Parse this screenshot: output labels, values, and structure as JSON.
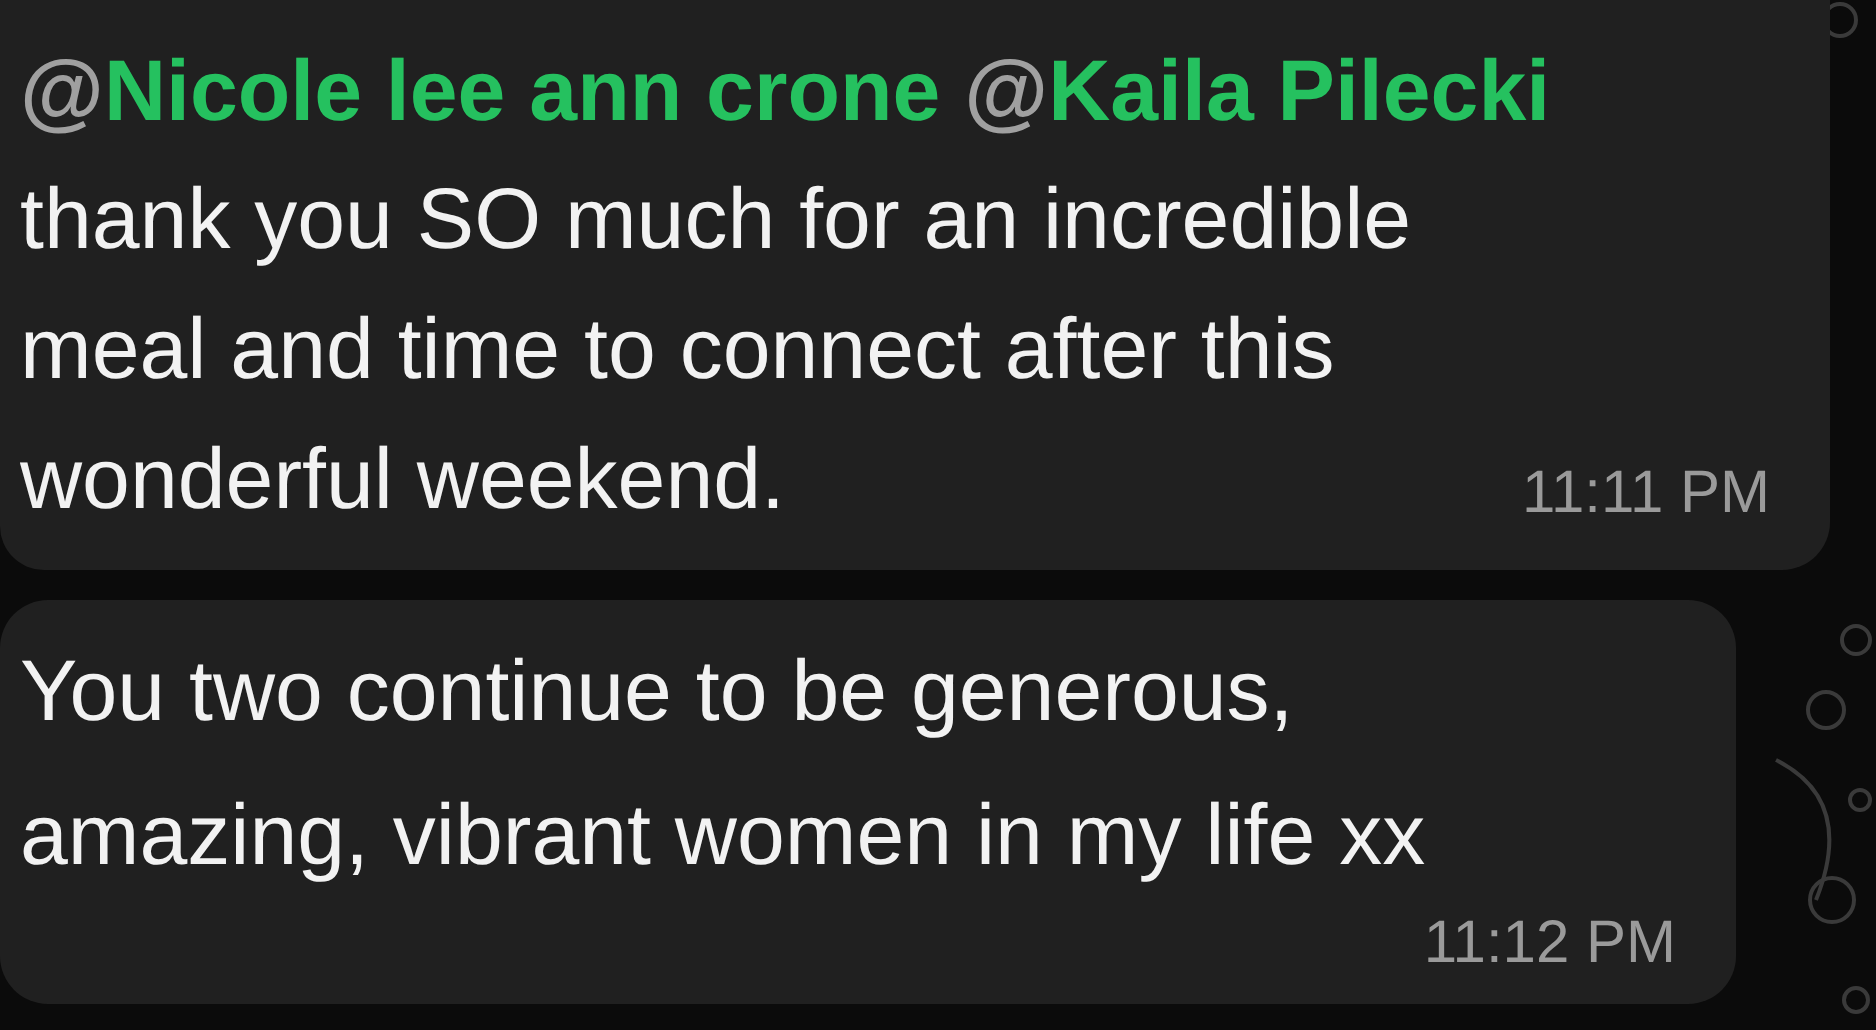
{
  "messages": [
    {
      "mentions": [
        {
          "at": "@",
          "name": "Nicole lee ann crone"
        },
        {
          "at": "@",
          "name": "Kaila Pilecki"
        }
      ],
      "text": "thank you SO much for an incredible\nmeal and time to connect after this\nwonderful weekend.",
      "time": "11:11 PM"
    },
    {
      "text": "You two continue to be generous,\namazing, vibrant women in my life xx",
      "time": "11:12 PM"
    }
  ]
}
